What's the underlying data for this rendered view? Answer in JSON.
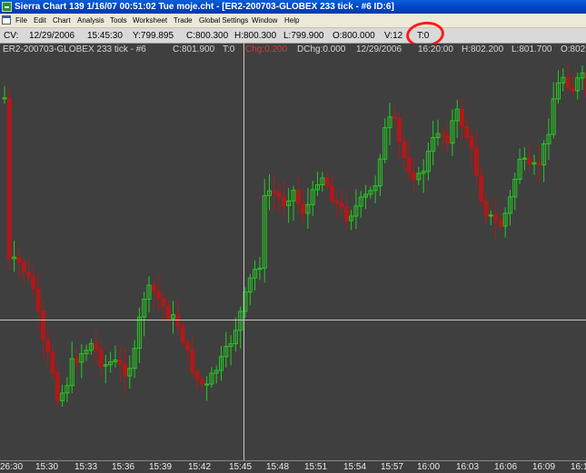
{
  "window": {
    "title": "Sierra Chart 139  1/16/07  00:51:02  Tue   moje.cht - [ER2-200703-GLOBEX  233 tick - #6  ID:6]",
    "app_icon": "chart-app-icon"
  },
  "menubar": {
    "items": [
      "File",
      "Edit",
      "Chart",
      "Analysis",
      "Tools",
      "Worksheet",
      "Trade",
      "Global Settings",
      "Window",
      "Help"
    ]
  },
  "cv_bar": {
    "label": "CV:",
    "date": "12/29/2006",
    "time": "15:45:30",
    "y": "Y:799.895",
    "c": "C:800.300",
    "h": "H:800.300",
    "l": "L:799.900",
    "o": "O:800.000",
    "v": "V:12",
    "t": "T:0"
  },
  "info_line": {
    "symbol": "ER2-200703-GLOBEX  233 tick - #6",
    "c": "C:801.900",
    "t": "T:0",
    "chg": "Chg:0.200",
    "dchg": "DChg:0.000",
    "date": "12/29/2006",
    "time": "16:20:00",
    "h": "H:802.200",
    "l": "L:801.700",
    "o": "O:802"
  },
  "colors": {
    "background": "#3f3f3f",
    "up_candle": "#22cc22",
    "down_candle": "#b01818",
    "crosshair": "#c8c8c8",
    "annotation": "#ff1a1a"
  },
  "x_axis": {
    "ticks": [
      "26:30",
      "15:30",
      "15:33",
      "15:36",
      "15:39",
      "15:42",
      "15:45",
      "15:48",
      "15:51",
      "15:54",
      "15:57",
      "16:00",
      "16:03",
      "16:06",
      "16:09",
      "16:1"
    ]
  }
}
